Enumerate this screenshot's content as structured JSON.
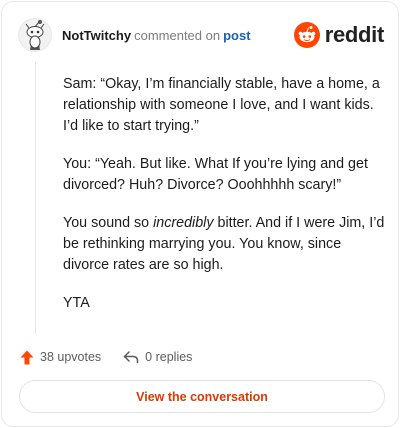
{
  "header": {
    "username": "NotTwitchy",
    "action": "commented on",
    "post_link": "post",
    "brand": "reddit"
  },
  "comment": {
    "paragraphs": [
      {
        "before": "Sam: “Okay, I’m financially stable, have a home, a relationship with someone I love, and I want kids. I’d like to start trying.”",
        "em": "",
        "after": ""
      },
      {
        "before": "You: “Yeah. But like. What If you’re lying and get divorced? Huh? Divorce? Ooohhhhh scary!”",
        "em": "",
        "after": ""
      },
      {
        "before": "You sound so ",
        "em": "incredibly",
        "after": " bitter. And if I were Jim, I’d be rethinking marrying you. You know, since divorce rates are so high."
      },
      {
        "before": "YTA",
        "em": "",
        "after": ""
      }
    ]
  },
  "footer": {
    "upvotes": "38 upvotes",
    "replies": "0 replies",
    "view_button": "View the conversation"
  },
  "colors": {
    "reddit_orange": "#ff4500",
    "link_blue": "#1c5fb8",
    "button_text": "#d93a00"
  }
}
